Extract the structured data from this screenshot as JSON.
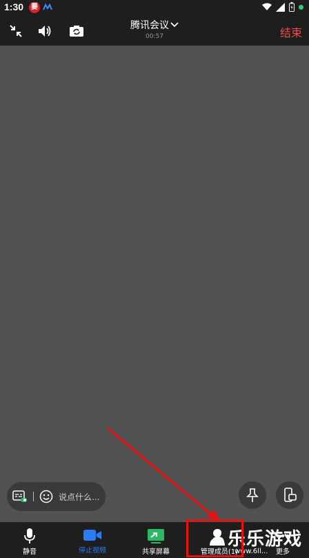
{
  "status": {
    "time": "1:30",
    "app_badge": "要"
  },
  "header": {
    "title": "腾讯会议",
    "timer": "00:57",
    "end_label": "结束"
  },
  "chat": {
    "placeholder": "说点什么..."
  },
  "bottom": {
    "tabs": [
      {
        "label": "静音"
      },
      {
        "label": "停止视频"
      },
      {
        "label": "共享屏幕"
      },
      {
        "label": "管理成员(1)"
      },
      {
        "label": "更多"
      }
    ]
  },
  "watermark": {
    "text": "乐乐游戏",
    "url": "www.6ll..."
  },
  "colors": {
    "accent": "#2b7bf3",
    "danger": "#f04848",
    "share_green": "#2cb964",
    "annotation": "#e81010"
  }
}
